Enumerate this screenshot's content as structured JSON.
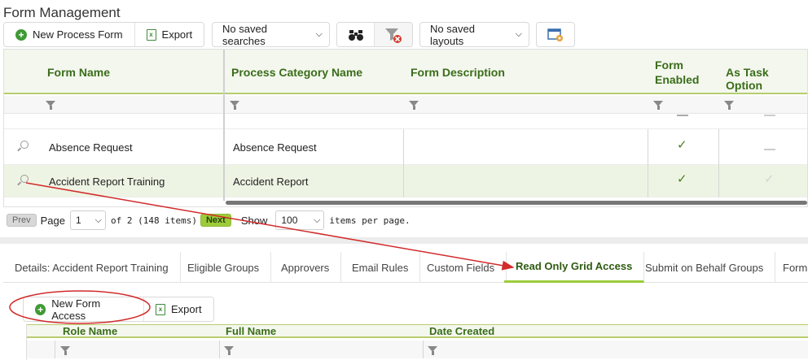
{
  "page": {
    "title": "Form Management"
  },
  "toolbar": {
    "new_label": "New Process Form",
    "export_label": "Export",
    "saved_searches": "No saved searches",
    "saved_layouts": "No saved layouts"
  },
  "grid": {
    "columns": [
      "Form Name",
      "Process Category Name",
      "Form Description",
      "Form Enabled",
      "As Task Option"
    ],
    "rows": [
      {
        "form_name": "Absence Request",
        "category": "Absence Request",
        "description": "",
        "enabled": true,
        "task_option": false
      },
      {
        "form_name": "Accident Report Training",
        "category": "Accident Report",
        "description": "",
        "enabled": true,
        "task_option": false
      }
    ]
  },
  "pager": {
    "prev": "Prev",
    "page_label": "Page",
    "page_value": "1",
    "of_text": "of 2 (148 items)",
    "next": "Next",
    "show_label": "Show",
    "page_size": "100",
    "per_page_text": "items per page."
  },
  "tabs": [
    {
      "label": "Details: Accident Report Training",
      "active": false
    },
    {
      "label": "Eligible Groups",
      "active": false
    },
    {
      "label": "Approvers",
      "active": false
    },
    {
      "label": "Email Rules",
      "active": false
    },
    {
      "label": "Custom Fields",
      "active": false
    },
    {
      "label": "Read Only Grid Access",
      "active": true
    },
    {
      "label": "Submit on Behalf Groups",
      "active": false
    },
    {
      "label": "Form",
      "active": false
    }
  ],
  "sub_toolbar": {
    "new_label": "New Form Access",
    "export_label": "Export"
  },
  "access_grid": {
    "columns": [
      "Role Name",
      "Full Name",
      "Date Created"
    ]
  },
  "colors": {
    "accent_green": "#9ccc3a",
    "header_text": "#3a6d1a",
    "annotation_red": "#d22b2b"
  }
}
